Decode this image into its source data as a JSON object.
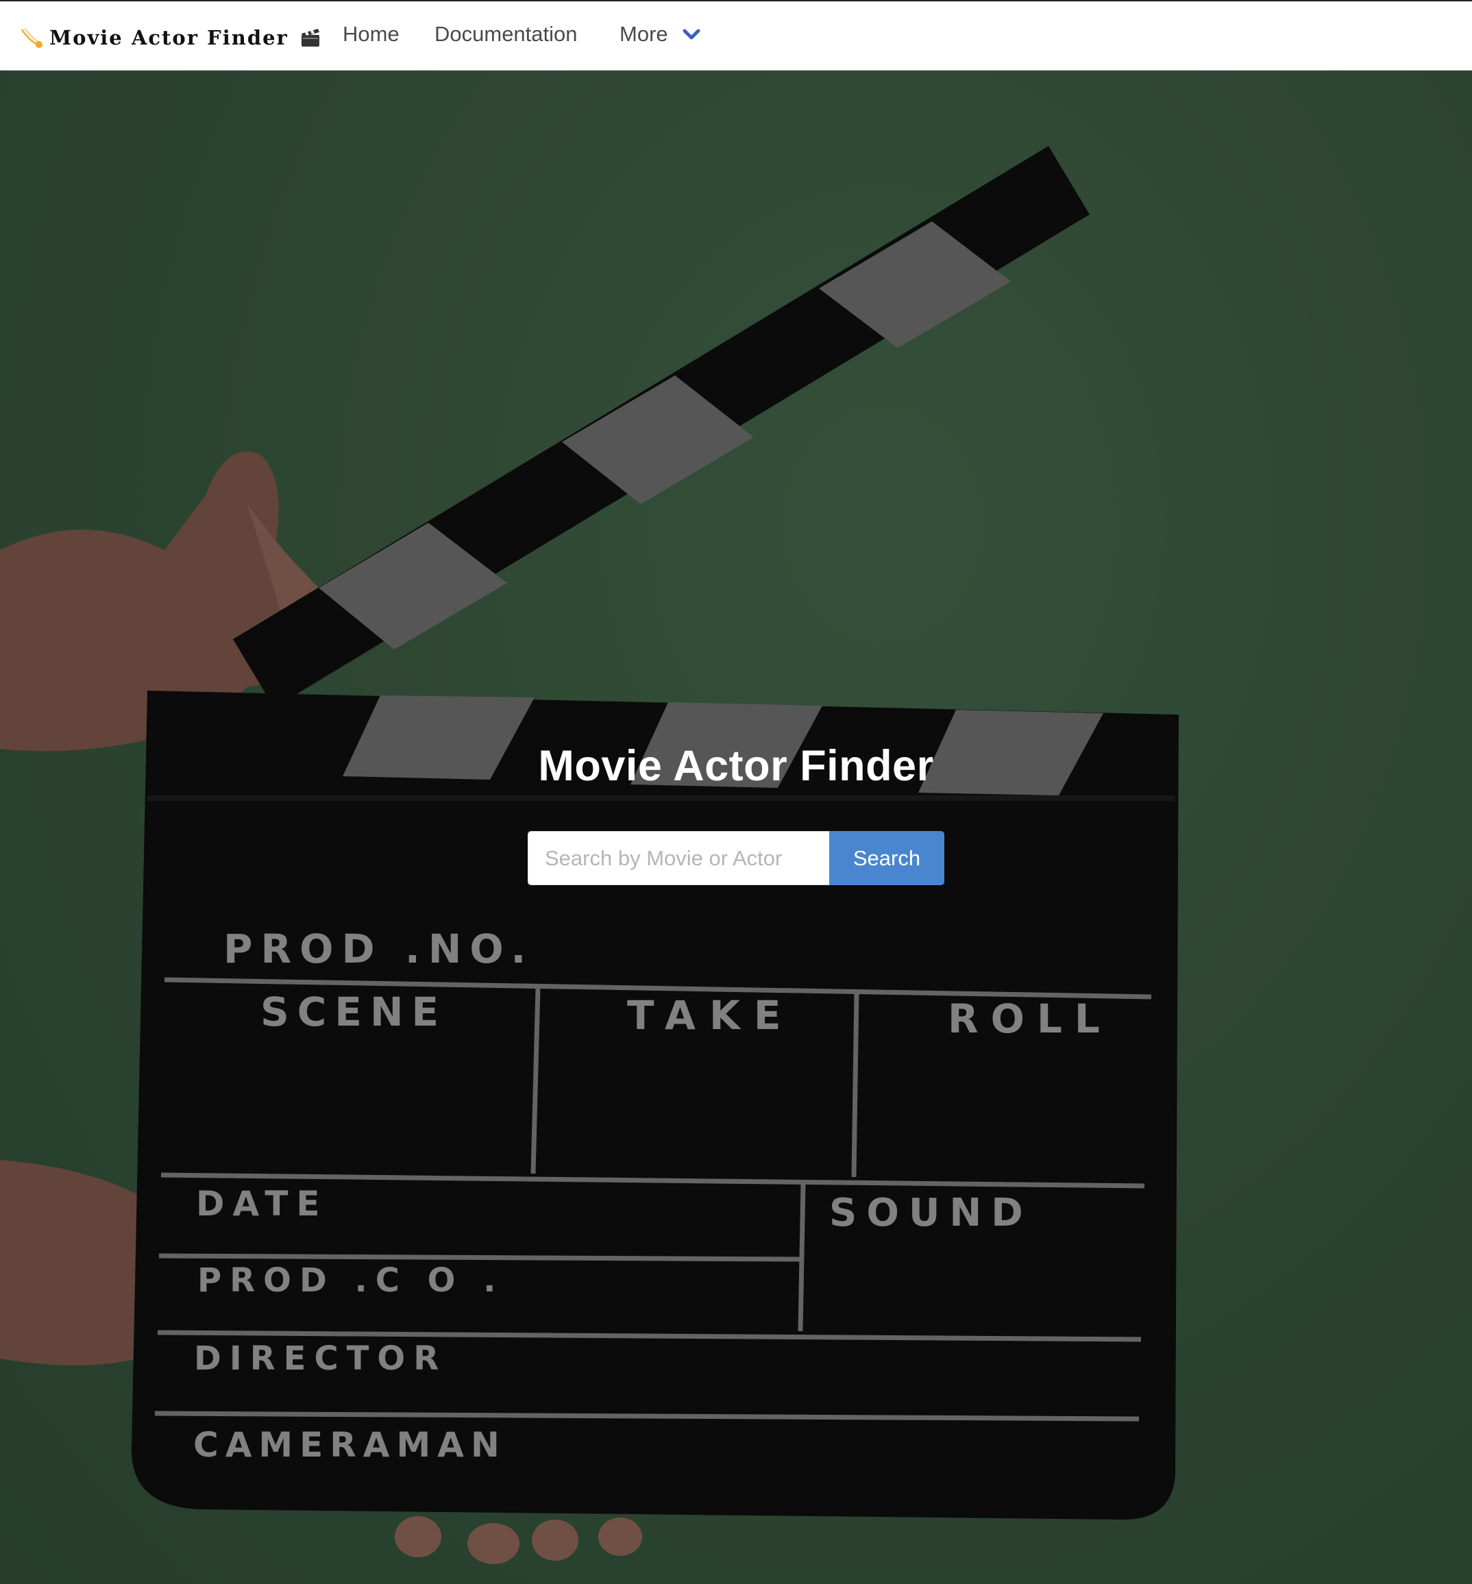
{
  "navbar": {
    "brand": "Movie Actor Finder",
    "brand_icons": [
      "comet-icon",
      "clapper-board-icon"
    ],
    "links": [
      {
        "label": "Home"
      },
      {
        "label": "Documentation"
      },
      {
        "label": "More",
        "icon": "chevron-down-icon"
      }
    ]
  },
  "hero": {
    "title": "Movie Actor Finder",
    "search": {
      "placeholder": "Search by Movie or Actor",
      "value": "",
      "button_label": "Search"
    },
    "background_image": "clapperboard-held-by-hands",
    "slate_labels": {
      "prod_no": "PROD .NO.",
      "scene": "SCENE",
      "take": "TAKE",
      "roll": "ROLL",
      "date": "DATE",
      "sound": "SOUND",
      "prod_co": "PROD .C O .",
      "director": "DIRECTOR",
      "cameraman": "CAMERAMAN"
    }
  },
  "colors": {
    "navbar_bg": "#ffffff",
    "hero_bg": "#2f4a35",
    "search_button": "#4a86cf",
    "chevron": "#3e5fc2",
    "title": "#ffffff"
  }
}
